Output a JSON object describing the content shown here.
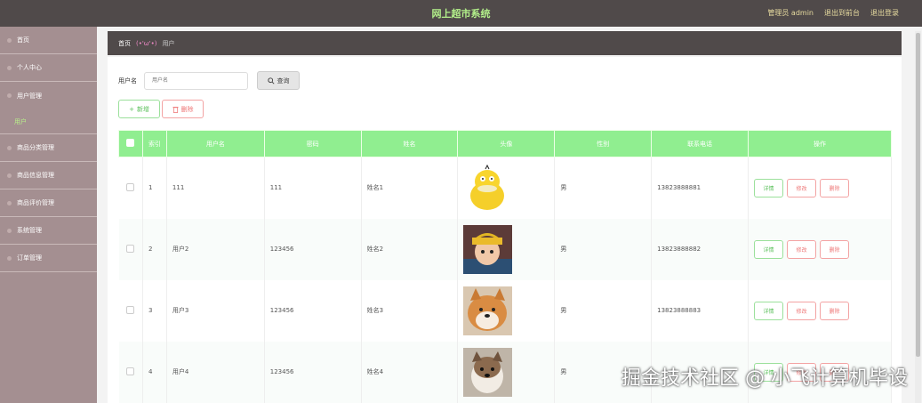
{
  "header": {
    "title": "网上超市系统",
    "role_user": "管理员 admin",
    "back_link": "退出到前台",
    "logout_link": "退出登录"
  },
  "sidebar": {
    "items": [
      {
        "label": "首页"
      },
      {
        "label": "个人中心"
      },
      {
        "label": "用户管理"
      },
      {
        "label": "商品分类管理"
      },
      {
        "label": "商品信息管理"
      },
      {
        "label": "商品评价管理"
      },
      {
        "label": "系统管理"
      },
      {
        "label": "订单管理"
      }
    ],
    "sub_active": "用户"
  },
  "breadcrumb": {
    "home": "首页",
    "sep": "(•'ω'•)",
    "current": "用户"
  },
  "search": {
    "label": "用户名",
    "placeholder": "用户名",
    "query_button": "查询"
  },
  "actions": {
    "add_label": "新增",
    "delete_label": "删除"
  },
  "table": {
    "headers": [
      "索引",
      "用户名",
      "密码",
      "姓名",
      "头像",
      "性别",
      "联系电话",
      "操作"
    ],
    "op_labels": {
      "detail": "详情",
      "edit": "修改",
      "delete": "删除"
    },
    "rows": [
      {
        "index": "1",
        "username": "111",
        "password": "111",
        "name": "姓名1",
        "gender": "男",
        "phone": "13823888881"
      },
      {
        "index": "2",
        "username": "用户2",
        "password": "123456",
        "name": "姓名2",
        "gender": "男",
        "phone": "13823888882"
      },
      {
        "index": "3",
        "username": "用户3",
        "password": "123456",
        "name": "姓名3",
        "gender": "男",
        "phone": "13823888883"
      },
      {
        "index": "4",
        "username": "用户4",
        "password": "123456",
        "name": "姓名4",
        "gender": "男",
        "phone": ""
      }
    ]
  },
  "colors": {
    "header_bg": "#504a4a",
    "sidebar_bg": "#a48f91",
    "table_head": "#90ee90",
    "title_color": "#b3f08a"
  },
  "watermark": "掘金技术社区 @ 小飞计算机毕设"
}
